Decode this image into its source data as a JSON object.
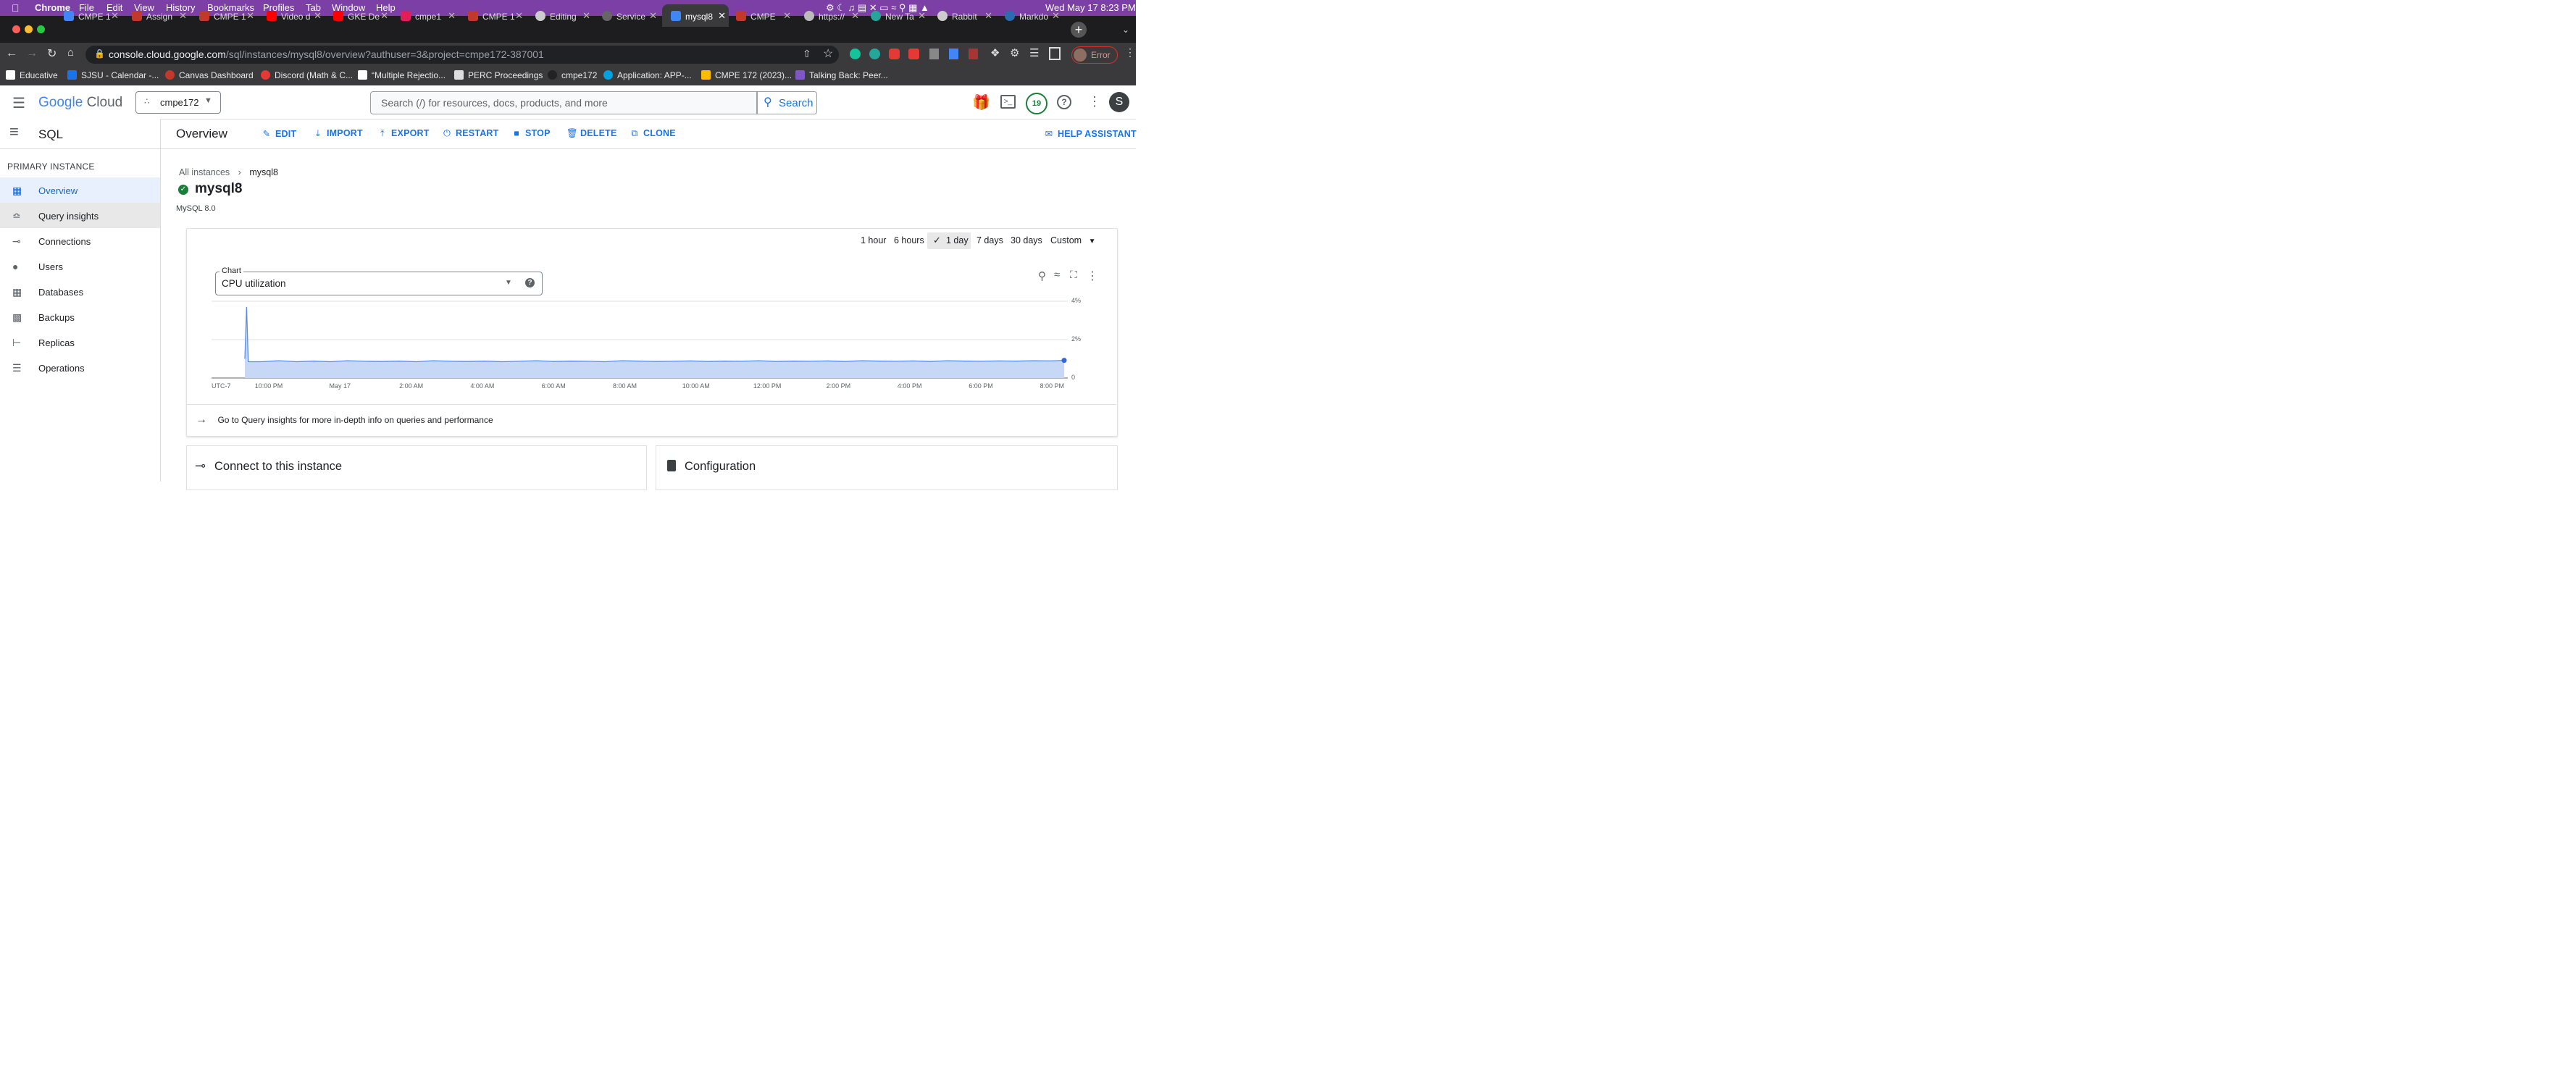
{
  "menubar": {
    "app": "Chrome",
    "items": [
      "File",
      "Edit",
      "View",
      "History",
      "Bookmarks",
      "Profiles",
      "Tab",
      "Window",
      "Help"
    ],
    "clock": "Wed May 17  8:23 PM"
  },
  "tabs": [
    {
      "label": "CMPE 1"
    },
    {
      "label": "Assign"
    },
    {
      "label": "CMPE 1"
    },
    {
      "label": "Video d"
    },
    {
      "label": "GKE De"
    },
    {
      "label": "cmpe1"
    },
    {
      "label": "CMPE 1"
    },
    {
      "label": "Editing"
    },
    {
      "label": "Service"
    },
    {
      "label": "mysql8"
    },
    {
      "label": "CMPE"
    },
    {
      "label": "https://"
    },
    {
      "label": "New Ta"
    },
    {
      "label": "Rabbit"
    },
    {
      "label": "Markdo"
    }
  ],
  "address": {
    "host": "console.cloud.google.com",
    "path": "/sql/instances/mysql8/overview?authuser=3&project=cmpe172-387001",
    "profile_status": "Error"
  },
  "bookmarks": [
    "Educative",
    "SJSU - Calendar -...",
    "Canvas Dashboard",
    "Discord (Math & C...",
    "“Multiple Rejectio...",
    "PERC Proceedings",
    "cmpe172",
    "Application: APP-...",
    "CMPE 172 (2023)...",
    "Talking Back: Peer..."
  ],
  "gcp": {
    "logo_google": "Google",
    "logo_cloud": "Cloud",
    "project": "cmpe172",
    "search_placeholder": "Search (/) for resources, docs, products, and more",
    "search_button": "Search",
    "notif_count": "19",
    "avatar": "S"
  },
  "sidebar": {
    "product": "SQL",
    "section": "PRIMARY INSTANCE",
    "items": [
      {
        "label": "Overview"
      },
      {
        "label": "Query insights"
      },
      {
        "label": "Connections"
      },
      {
        "label": "Users"
      },
      {
        "label": "Databases"
      },
      {
        "label": "Backups"
      },
      {
        "label": "Replicas"
      },
      {
        "label": "Operations"
      }
    ]
  },
  "toolbar": {
    "title": "Overview",
    "edit": "EDIT",
    "import": "IMPORT",
    "export": "EXPORT",
    "restart": "RESTART",
    "stop": "STOP",
    "delete": "DELETE",
    "clone": "CLONE",
    "help": "HELP ASSISTANT"
  },
  "breadcrumb": {
    "root": "All instances",
    "current": "mysql8"
  },
  "instance": {
    "name": "mysql8",
    "version": "MySQL 8.0"
  },
  "ranges": {
    "h1": "1 hour",
    "h6": "6 hours",
    "d1": "1 day",
    "d7": "7 days",
    "d30": "30 days",
    "custom": "Custom"
  },
  "chart_selector": {
    "label": "Chart",
    "value": "CPU utilization"
  },
  "chart_data": {
    "type": "area",
    "timezone_label": "UTC-7",
    "x_ticks": [
      "10:00 PM",
      "May 17",
      "2:00 AM",
      "4:00 AM",
      "6:00 AM",
      "8:00 AM",
      "10:00 AM",
      "12:00 PM",
      "2:00 PM",
      "4:00 PM",
      "6:00 PM",
      "8:00 PM"
    ],
    "y_ticks": [
      "4%",
      "2%",
      "0"
    ],
    "ylim": [
      0,
      4
    ],
    "series": [
      {
        "x_hours_from_start": [
          0,
          0.05,
          0.1,
          0.5,
          1,
          1.5,
          2,
          2.5,
          3,
          3.5,
          4,
          4.5,
          5,
          5.5,
          6,
          6.5,
          7,
          7.5,
          8,
          8.5,
          9,
          9.5,
          10,
          10.5,
          11,
          11.5,
          12,
          12.5,
          13,
          13.5,
          14,
          14.5,
          15,
          15.5,
          16,
          16.5,
          17,
          17.5,
          18,
          18.5,
          19,
          19.5,
          20,
          20.5,
          21,
          21.5,
          22,
          22.5,
          23,
          23.5,
          23.9
        ],
        "values": [
          1.0,
          3.7,
          0.85,
          0.85,
          0.9,
          0.85,
          0.88,
          0.85,
          0.9,
          0.87,
          0.86,
          0.88,
          0.85,
          0.9,
          0.87,
          0.86,
          0.88,
          0.85,
          0.87,
          0.9,
          0.86,
          0.88,
          0.87,
          0.85,
          0.9,
          0.88,
          0.86,
          0.87,
          0.89,
          0.86,
          0.88,
          0.87,
          0.9,
          0.86,
          0.88,
          0.87,
          0.89,
          0.86,
          0.9,
          0.88,
          0.87,
          0.89,
          0.86,
          0.9,
          0.88,
          0.87,
          0.89,
          0.88,
          0.9,
          0.89,
          0.92
        ]
      }
    ],
    "grid": true
  },
  "insights_link": "Go to Query insights for more in-depth info on queries and performance",
  "cards": {
    "connect": "Connect to this instance",
    "config": "Configuration"
  },
  "colors": {
    "accent": "#1a73e8",
    "area": "#c6d8f5",
    "line": "#5b8def",
    "menubar": "#7b3fa6"
  }
}
